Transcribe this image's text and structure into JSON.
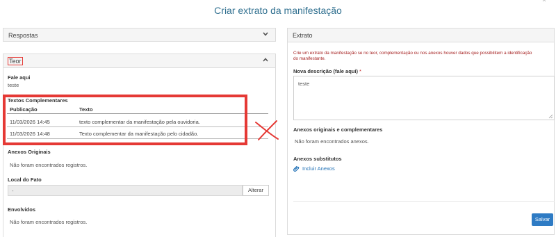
{
  "page": {
    "title": "Criar extrato da manifestação",
    "corner_mark": "^"
  },
  "left": {
    "respostas_label": "Respostas",
    "teor_label": "Teor",
    "fale_aqui_label": "Fale aqui",
    "fale_aqui_value": "teste",
    "textos_complementares_label": "Textos Complementares",
    "table": {
      "headers": [
        "Publicação",
        "Texto"
      ],
      "rows": [
        [
          "11/03/2026 14:45",
          "texto complementar da manifestação pela ouvidoria."
        ],
        [
          "11/03/2026 14:48",
          "Texto complementar da manifestação pelo cidadão."
        ]
      ]
    },
    "anexos_originais_label": "Anexos Originais",
    "anexos_originais_value": "Não foram encontrados registros.",
    "local_do_fato_label": "Local do Fato",
    "local_do_fato_value": "-",
    "alterar_button": "Alterar",
    "envolvidos_label": "Envolvidos",
    "envolvidos_value": "Não foram encontrados registros."
  },
  "right": {
    "header": "Extrato",
    "warning": "Crie um extrato da manifestação se no teor, complementação ou nos anexos houver dados que possibilitem a identificação do manifestante.",
    "nova_descricao_label": "Nova descrição (fale aqui)",
    "required_mark": "*",
    "nova_descricao_value": "teste",
    "anexos_orig_comp_label": "Anexos originais e complementares",
    "anexos_orig_comp_value": "Não foram encontrados anexos.",
    "anexos_substitutos_label": "Anexos substitutos",
    "incluir_anexos_link": "Incluir Anexos",
    "salvar_button": "Salvar"
  },
  "colors": {
    "title": "#2f6f8f",
    "annotation_red": "#e53935",
    "warning_text": "#a52020",
    "link": "#1e6fb5",
    "primary_button": "#2e7bc4"
  }
}
